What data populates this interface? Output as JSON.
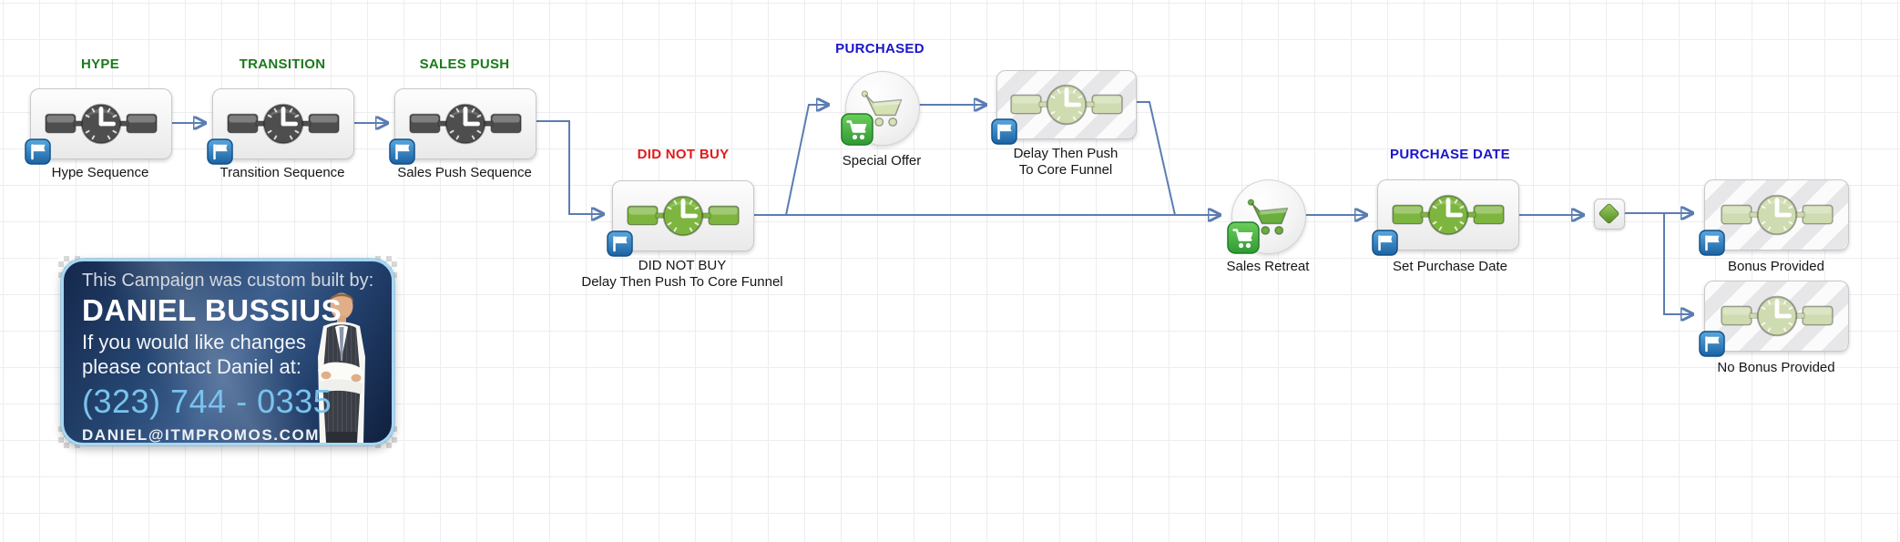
{
  "canvas": {
    "background": "#ffffff",
    "grid_color": "#ededf1"
  },
  "colors": {
    "connector": "#5b7db1",
    "heading_green": "#1b7a1b",
    "heading_red": "#e01b1b",
    "heading_blue": "#1a15cc",
    "sequence_gray": "#4e4e4e",
    "sequence_green": "#7db53f",
    "sequence_pale_green": "#cfdbb0",
    "flag_badge_blue": "#2d7fc1",
    "cart_badge_green": "#3fae3f"
  },
  "headings": {
    "hype": "HYPE",
    "transition": "TRANSITION",
    "sales_push": "SALES PUSH",
    "did_not_buy": "DID NOT BUY",
    "purchased": "PURCHASED",
    "purchase_date": "PURCHASE DATE"
  },
  "nodes": {
    "hype": {
      "label": "Hype Sequence"
    },
    "transition": {
      "label": "Transition Sequence"
    },
    "sales_push": {
      "label": "Sales Push Sequence"
    },
    "did_not_buy": {
      "label_line1": "DID NOT BUY",
      "label_line2": "Delay Then Push To Core Funnel"
    },
    "special_offer": {
      "label": "Special Offer"
    },
    "delay_then_push": {
      "label_line1": "Delay Then Push",
      "label_line2": "To Core Funnel"
    },
    "sales_retreat": {
      "label": "Sales Retreat"
    },
    "set_purchase_date": {
      "label": "Set Purchase Date"
    },
    "bonus_provided": {
      "label": "Bonus Provided"
    },
    "no_bonus_provided": {
      "label": "No Bonus Provided"
    }
  },
  "flow": [
    {
      "from": "hype",
      "to": "transition"
    },
    {
      "from": "transition",
      "to": "sales_push"
    },
    {
      "from": "sales_push",
      "to": "did_not_buy"
    },
    {
      "from": "did_not_buy",
      "to": "special_offer"
    },
    {
      "from": "did_not_buy",
      "to": "sales_retreat"
    },
    {
      "from": "special_offer",
      "to": "delay_then_push"
    },
    {
      "from": "delay_then_push",
      "to": "sales_retreat"
    },
    {
      "from": "sales_retreat",
      "to": "set_purchase_date"
    },
    {
      "from": "set_purchase_date",
      "to": "decision_diamond"
    },
    {
      "from": "decision_diamond",
      "to": "bonus_provided"
    },
    {
      "from": "decision_diamond",
      "to": "no_bonus_provided"
    }
  ],
  "builder_badge": {
    "intro": "This Campaign was custom built by:",
    "name": "DANIEL BUSSIUS",
    "line1": "If you would like changes",
    "line2": "please contact Daniel at:",
    "phone": "(323) 744 - 0335",
    "email": "DANIEL@ITMPROMOS.COM"
  }
}
